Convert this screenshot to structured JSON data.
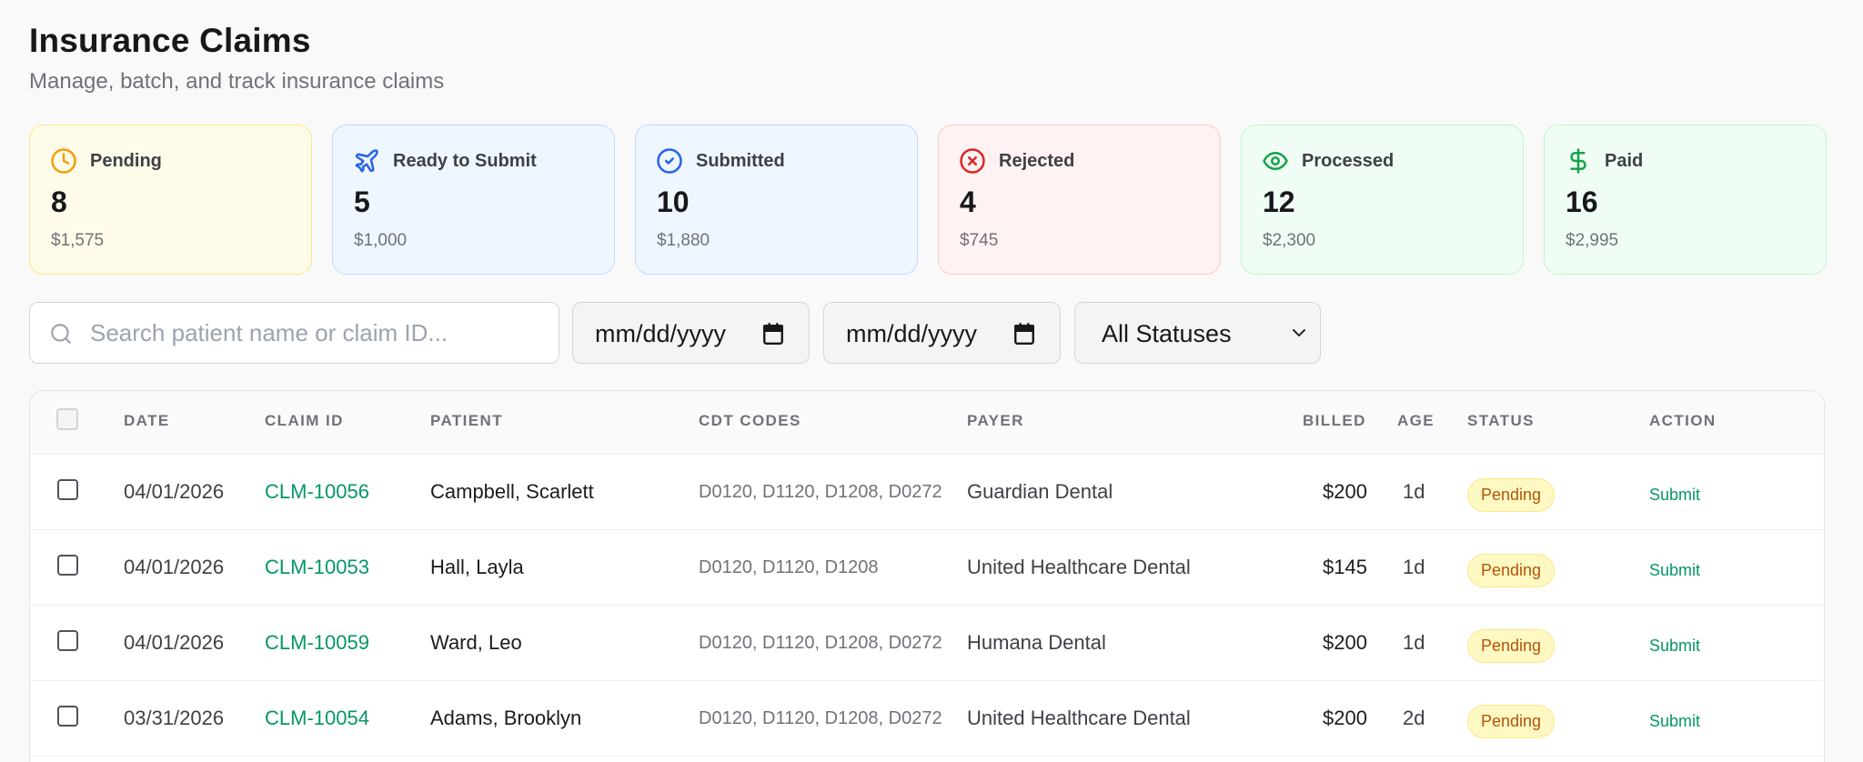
{
  "header": {
    "title": "Insurance Claims",
    "subtitle": "Manage, batch, and track insurance claims"
  },
  "colors": {
    "accent_green": "#059669",
    "pending": "#f59e0b",
    "blue": "#2563eb",
    "rejected": "#dc2626",
    "success": "#16a34a"
  },
  "cards": [
    {
      "label": "Pending",
      "count": "8",
      "amount": "$1,575",
      "icon": "clock-icon"
    },
    {
      "label": "Ready to Submit",
      "count": "5",
      "amount": "$1,000",
      "icon": "plane-icon"
    },
    {
      "label": "Submitted",
      "count": "10",
      "amount": "$1,880",
      "icon": "check-circle-icon"
    },
    {
      "label": "Rejected",
      "count": "4",
      "amount": "$745",
      "icon": "x-circle-icon"
    },
    {
      "label": "Processed",
      "count": "12",
      "amount": "$2,300",
      "icon": "eye-icon"
    },
    {
      "label": "Paid",
      "count": "16",
      "amount": "$2,995",
      "icon": "dollar-icon"
    }
  ],
  "filters": {
    "search_placeholder": "Search patient name or claim ID...",
    "date_from": "mm/dd/yyyy",
    "date_to": "mm/dd/yyyy",
    "status": "All Statuses"
  },
  "table": {
    "columns": {
      "date": "Date",
      "claim_id": "Claim ID",
      "patient": "Patient",
      "cdt_codes": "CDT Codes",
      "payer": "Payer",
      "billed": "Billed",
      "age": "Age",
      "status": "Status",
      "action": "Action"
    },
    "rows": [
      {
        "date": "04/01/2026",
        "claim_id": "CLM-10056",
        "patient": "Campbell, Scarlett",
        "codes": "D0120, D1120, D1208, D0272",
        "payer": "Guardian Dental",
        "billed": "$200",
        "age": "1d",
        "status": "Pending",
        "action": "Submit"
      },
      {
        "date": "04/01/2026",
        "claim_id": "CLM-10053",
        "patient": "Hall, Layla",
        "codes": "D0120, D1120, D1208",
        "payer": "United Healthcare Dental",
        "billed": "$145",
        "age": "1d",
        "status": "Pending",
        "action": "Submit"
      },
      {
        "date": "04/01/2026",
        "claim_id": "CLM-10059",
        "patient": "Ward, Leo",
        "codes": "D0120, D1120, D1208, D0272",
        "payer": "Humana Dental",
        "billed": "$200",
        "age": "1d",
        "status": "Pending",
        "action": "Submit"
      },
      {
        "date": "03/31/2026",
        "claim_id": "CLM-10054",
        "patient": "Adams, Brooklyn",
        "codes": "D0120, D1120, D1208, D0272",
        "payer": "United Healthcare Dental",
        "billed": "$200",
        "age": "2d",
        "status": "Pending",
        "action": "Submit"
      }
    ]
  }
}
